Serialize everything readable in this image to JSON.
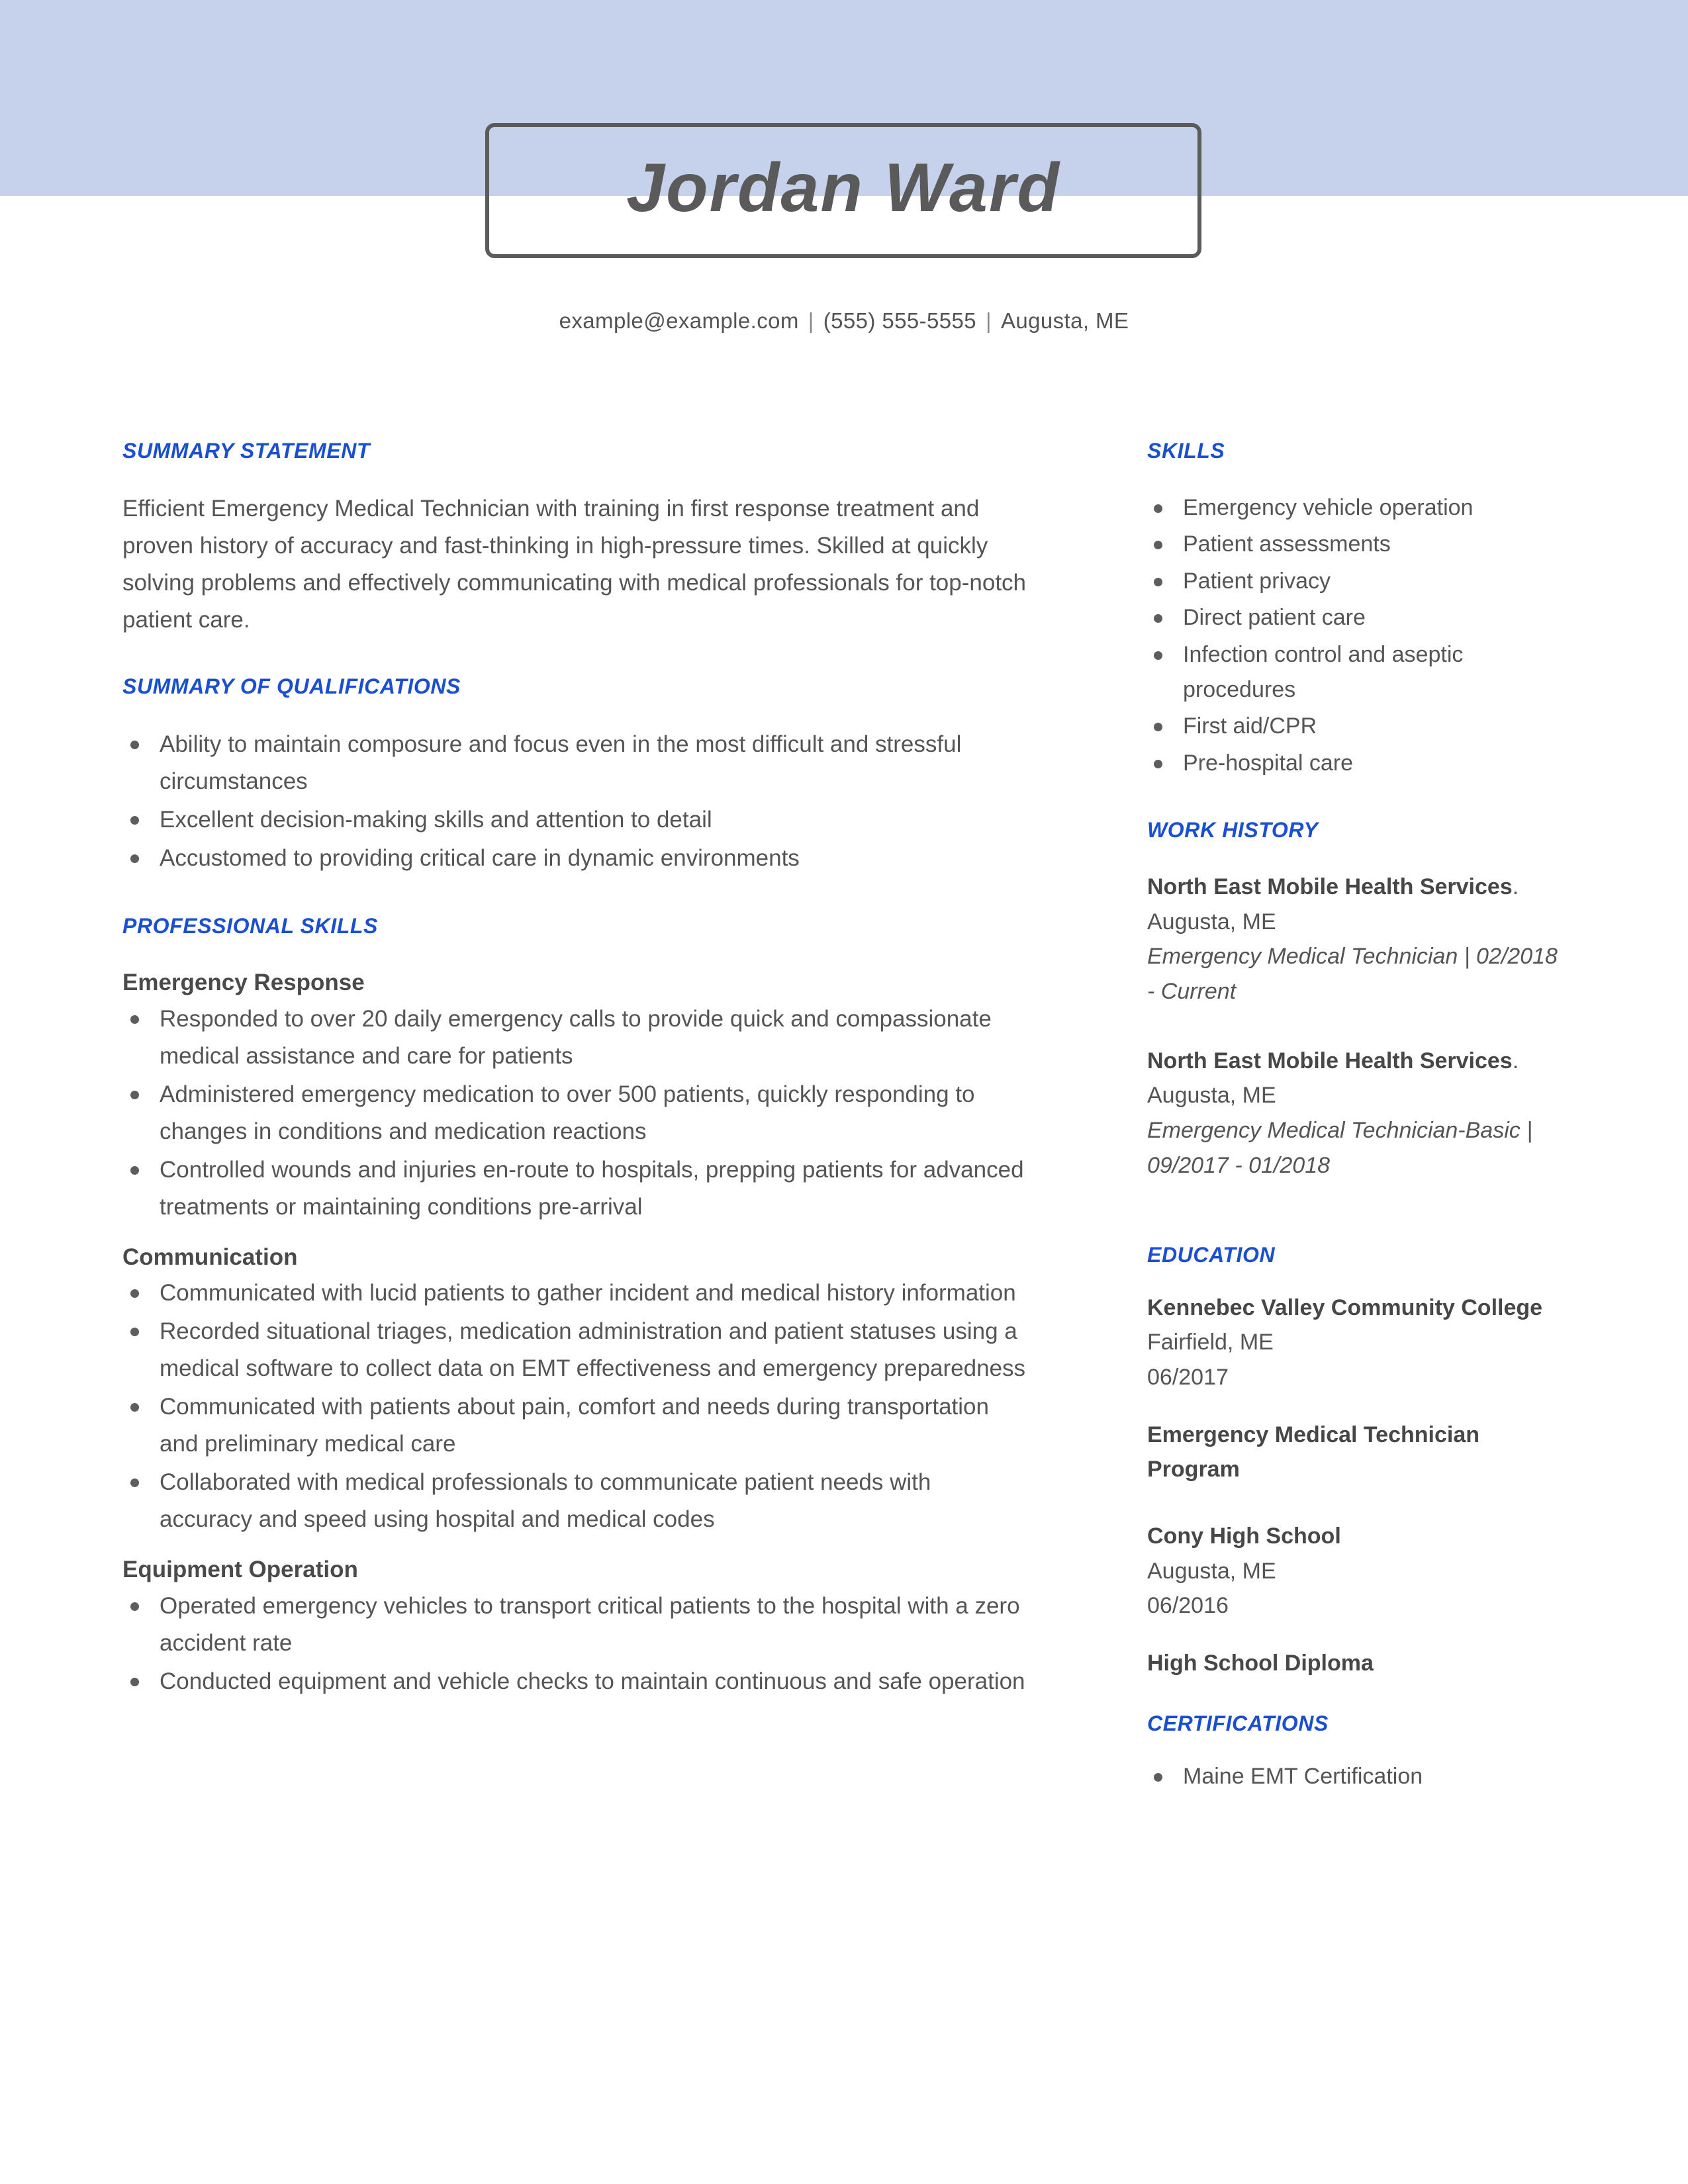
{
  "theme": {
    "band_color": "#c6d1ec",
    "heading_blue": "#1b4fd1",
    "body_gray": "#555555",
    "box_border": "#5c5c5c"
  },
  "header": {
    "name": "Jordan Ward",
    "contact": {
      "email": "example@example.com",
      "phone": "(555) 555-5555",
      "location": "Augusta, ME",
      "separator": "|"
    }
  },
  "left_column": {
    "summary_statement": {
      "heading": "SUMMARY STATEMENT",
      "text": "Efficient Emergency Medical Technician with training in first response treatment and proven history of accuracy and fast-thinking in high-pressure times. Skilled at quickly solving problems and effectively communicating with medical professionals for top-notch patient care."
    },
    "summary_of_qualifications": {
      "heading": "SUMMARY OF QUALIFICATIONS",
      "items": [
        "Ability to maintain composure and focus even in the most difficult and stressful circumstances",
        "Excellent decision-making skills and attention to detail",
        "Accustomed to providing critical care in dynamic environments"
      ]
    },
    "professional_skills": {
      "heading": "PROFESSIONAL SKILLS",
      "groups": [
        {
          "title": "Emergency Response",
          "items": [
            "Responded to over 20 daily emergency calls to provide quick and compassionate medical assistance and care for patients",
            "Administered emergency medication to over 500 patients, quickly responding to changes in conditions and medication reactions",
            "Controlled wounds and injuries en-route to hospitals, prepping patients for advanced treatments or maintaining conditions pre-arrival"
          ]
        },
        {
          "title": "Communication",
          "items": [
            "Communicated with lucid patients to gather incident and medical history information",
            "Recorded situational triages, medication administration and patient statuses using a medical software to collect data on EMT effectiveness and emergency preparedness",
            "Communicated with patients about pain, comfort and needs during transportation and preliminary medical care",
            "Collaborated with medical professionals to communicate patient needs with accuracy and speed using hospital and medical codes"
          ]
        },
        {
          "title": "Equipment Operation",
          "items": [
            "Operated emergency vehicles to transport critical patients to the hospital with a zero accident rate",
            "Conducted equipment and vehicle checks to maintain continuous and safe operation"
          ]
        }
      ]
    }
  },
  "right_column": {
    "skills": {
      "heading": "SKILLS",
      "items": [
        "Emergency vehicle operation",
        "Patient assessments",
        "Patient privacy",
        "Direct patient care",
        "Infection control and aseptic procedures",
        "First aid/CPR",
        "Pre-hospital care"
      ]
    },
    "work_history": {
      "heading": "WORK HISTORY",
      "entries": [
        {
          "organization": "North East Mobile Health Services",
          "location": ". Augusta, ME",
          "role": "Emergency Medical Technician  |  02/2018 - Current"
        },
        {
          "organization": "North East Mobile Health Services",
          "location": ". Augusta, ME",
          "role": "Emergency Medical Technician-Basic  |  09/2017 - 01/2018"
        }
      ]
    },
    "education": {
      "heading": "EDUCATION",
      "entries": [
        {
          "school": "Kennebec Valley Community College",
          "place": "Fairfield, ME",
          "date": "06/2017",
          "degree": "Emergency Medical Technician Program"
        },
        {
          "school": "Cony High School",
          "place": "Augusta, ME",
          "date": "06/2016",
          "degree": "High School Diploma"
        }
      ]
    },
    "certifications": {
      "heading": "CERTIFICATIONS",
      "items": [
        "Maine EMT Certification"
      ]
    }
  }
}
